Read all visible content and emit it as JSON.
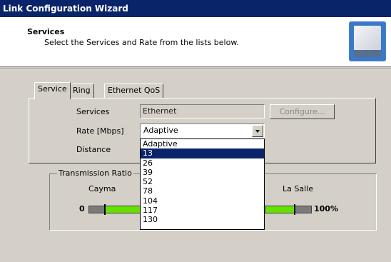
{
  "window": {
    "title": "Link Configuration Wizard"
  },
  "header": {
    "title": "Services",
    "subtitle": "Select the Services and Rate from the lists below.",
    "icon": "wizard-device-icon"
  },
  "tabs": [
    {
      "label": "Service",
      "active": true
    },
    {
      "label": "Ring",
      "active": false
    },
    {
      "label": "Ethernet QoS",
      "active": false
    }
  ],
  "service": {
    "services_label": "Services",
    "services_value": "Ethernet",
    "configure_label": "Configure...",
    "rate_label": "Rate [Mbps]",
    "rate_value": "Adaptive",
    "distance_label": "Distance"
  },
  "rate_options": [
    {
      "label": "Adaptive",
      "selected": false
    },
    {
      "label": "13",
      "selected": true
    },
    {
      "label": "26",
      "selected": false
    },
    {
      "label": "39",
      "selected": false
    },
    {
      "label": "52",
      "selected": false
    },
    {
      "label": "78",
      "selected": false
    },
    {
      "label": "104",
      "selected": false
    },
    {
      "label": "117",
      "selected": false
    },
    {
      "label": "130",
      "selected": false
    }
  ],
  "transmission": {
    "group_label": "Transmission Ratio",
    "site_a": "Cayma",
    "site_b": "La Salle",
    "min_label": "0",
    "max_label": "100%"
  },
  "colors": {
    "titlebar": "#0a246a",
    "bar_fill": "#66e000",
    "selection": "#0a246a"
  }
}
